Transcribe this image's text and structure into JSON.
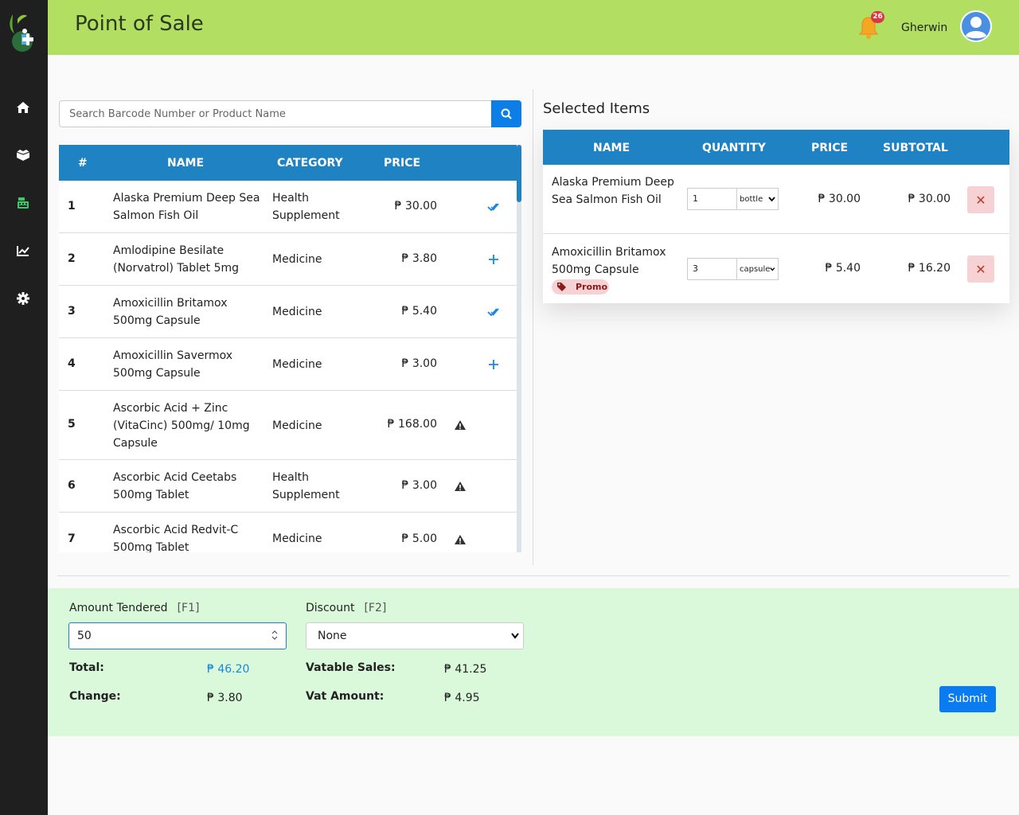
{
  "app": {
    "title": "Point of Sale",
    "user_name": "Gherwin",
    "notification_count": "26"
  },
  "colors": {
    "header": "#b2de62",
    "sidebar": "#1f1f1f",
    "table_header": "#1f82c3",
    "active_nav": "#3ec76a",
    "bottom_panel": "#d9f9da",
    "submit": "#0b7bf0"
  },
  "sidebar": {
    "items": [
      {
        "icon": "home-icon"
      },
      {
        "icon": "box-icon"
      },
      {
        "icon": "cash-register-icon",
        "active": true
      },
      {
        "icon": "chart-line-icon"
      },
      {
        "icon": "gear-icon"
      }
    ]
  },
  "search": {
    "placeholder": "Search Barcode Number or Product Name"
  },
  "products": {
    "headers": {
      "num": "#",
      "name": "NAME",
      "category": "CATEGORY",
      "price": "PRICE"
    },
    "rows": [
      {
        "num": "1",
        "name_l1": "Alaska Premium Deep Sea",
        "name_l2": "Salmon Fish Oil",
        "cat_l1": "Health",
        "cat_l2": "Supplement",
        "price": "₱ 30.00",
        "action": "check-double-icon"
      },
      {
        "num": "2",
        "name_l1": "Amlodipine Besilate",
        "name_l2": "(Norvatrol) Tablet 5mg",
        "cat_l1": "Medicine",
        "cat_l2": "",
        "price": "₱ 3.80",
        "action": "plus-icon"
      },
      {
        "num": "3",
        "name_l1": "Amoxicillin Britamox",
        "name_l2": "500mg Capsule",
        "cat_l1": "Medicine",
        "cat_l2": "",
        "price": "₱ 5.40",
        "action": "check-double-icon"
      },
      {
        "num": "4",
        "name_l1": "Amoxicillin Savermox",
        "name_l2": "500mg Capsule",
        "cat_l1": "Medicine",
        "cat_l2": "",
        "price": "₱ 3.00",
        "action": "plus-icon"
      },
      {
        "num": "5",
        "name_l1": "Ascorbic Acid + Zinc",
        "name_l2": "(VitaCinc) 500mg/ 10mg",
        "name_l3": "Capsule",
        "cat_l1": "Medicine",
        "cat_l2": "",
        "price": "₱ 168.00",
        "action": "warning-icon"
      },
      {
        "num": "6",
        "name_l1": "Ascorbic Acid Ceetabs",
        "name_l2": "500mg Tablet",
        "cat_l1": "Health",
        "cat_l2": "Supplement",
        "price": "₱ 3.00",
        "action": "warning-icon"
      },
      {
        "num": "7",
        "name_l1": "Ascorbic Acid Redvit-C",
        "name_l2": "500mg Tablet",
        "cat_l1": "Medicine",
        "cat_l2": "",
        "price": "₱ 5.00",
        "action": "warning-icon"
      }
    ]
  },
  "selected": {
    "title": "Selected Items",
    "headers": {
      "name": "NAME",
      "quantity": "QUANTITY",
      "price": "PRICE",
      "subtotal": "SUBTOTAL"
    },
    "rows": [
      {
        "name_l1": "Alaska Premium Deep",
        "name_l2": "Sea Salmon Fish Oil",
        "qty": "1",
        "unit": "bottle",
        "price": "₱ 30.00",
        "subtotal": "₱ 30.00",
        "promo": ""
      },
      {
        "name_l1": "Amoxicillin Britamox",
        "name_l2": "500mg Capsule",
        "qty": "3",
        "unit": "capsule",
        "price": "₱ 5.40",
        "subtotal": "₱ 16.20",
        "promo": "Promo"
      }
    ]
  },
  "payment": {
    "amount_label": "Amount Tendered",
    "amount_key": "[F1]",
    "amount_value": "50",
    "discount_label": "Discount",
    "discount_key": "[F2]",
    "discount_value": "None",
    "total_label": "Total:",
    "total_value": "₱ 46.20",
    "change_label": "Change:",
    "change_value": "₱ 3.80",
    "vatable_label": "Vatable Sales:",
    "vatable_value": "₱ 41.25",
    "vat_label": "Vat Amount:",
    "vat_value": "₱ 4.95",
    "submit_label": "Submit"
  }
}
